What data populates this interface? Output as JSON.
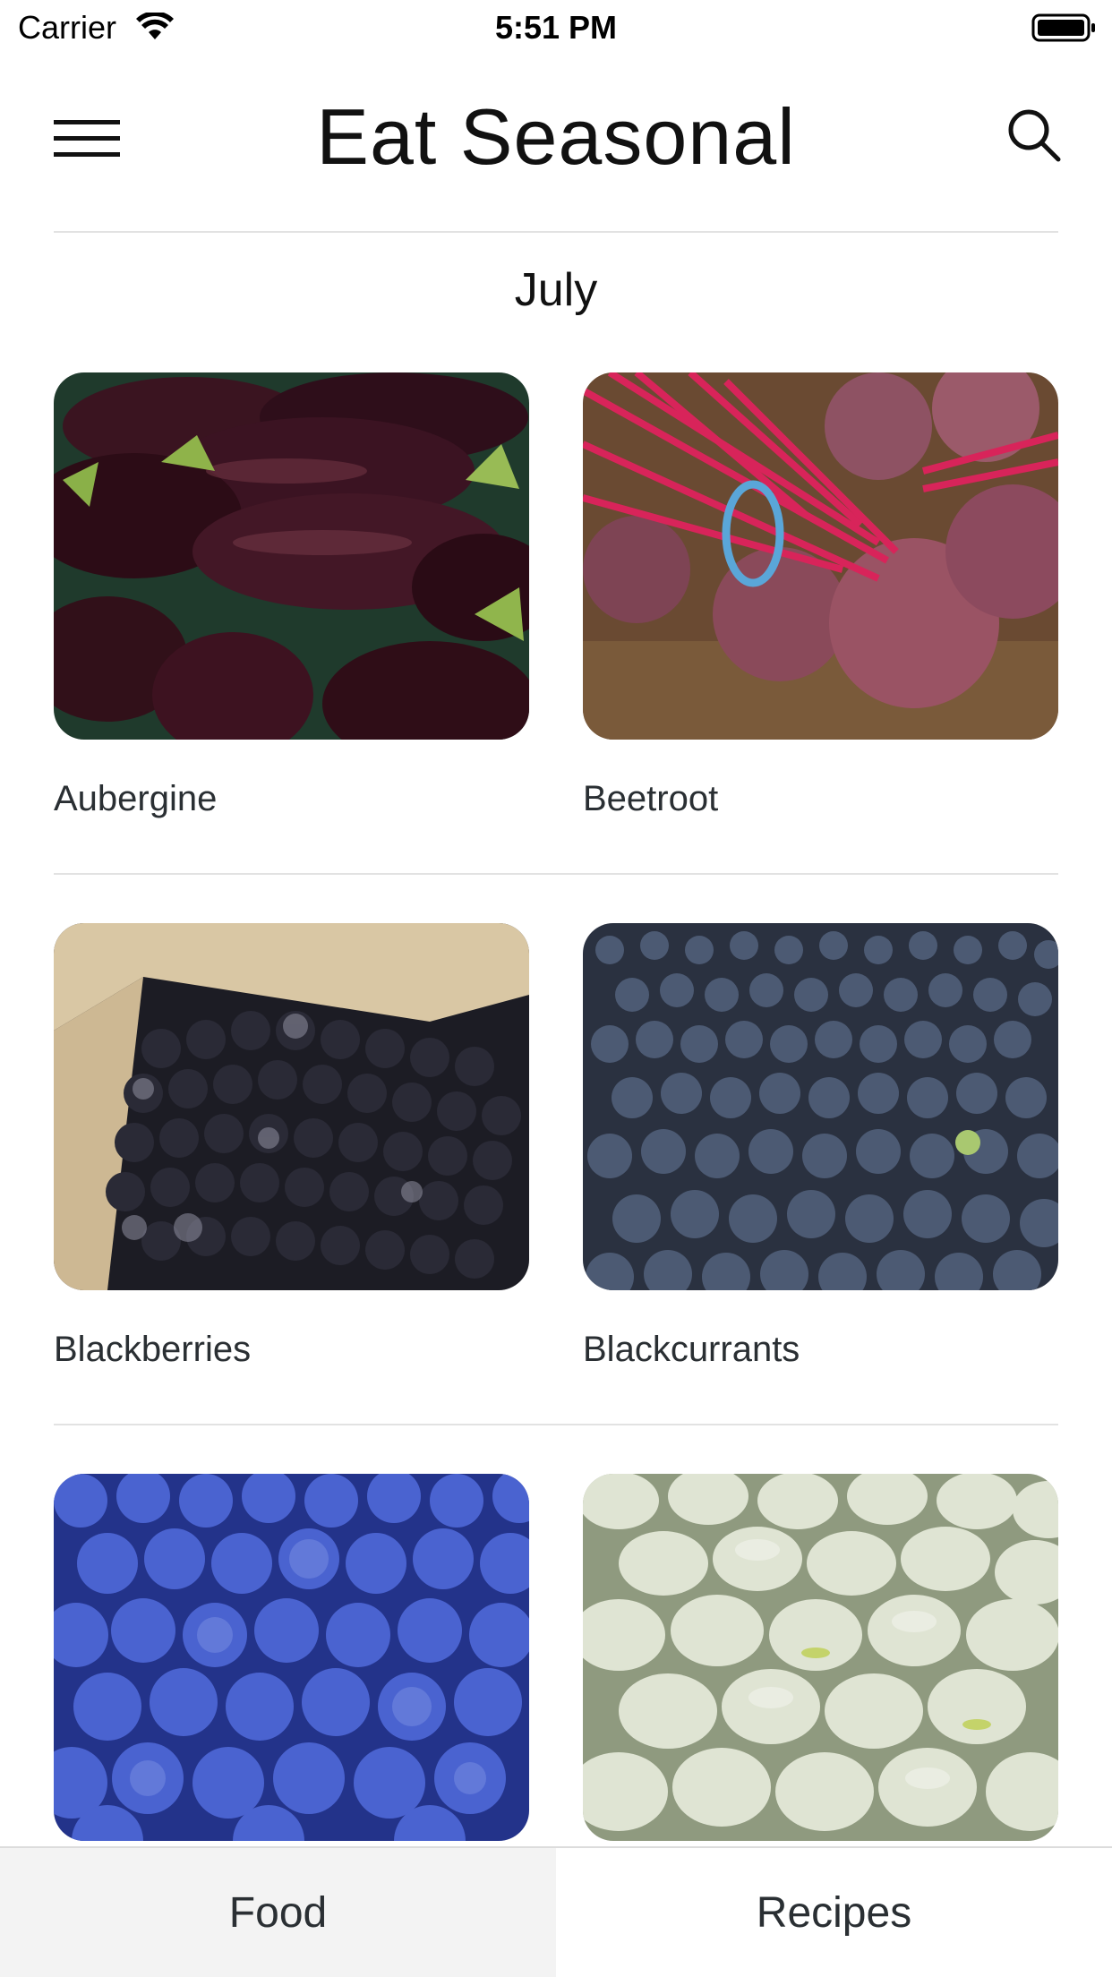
{
  "status_bar": {
    "carrier": "Carrier",
    "time": "5:51 PM",
    "icons": [
      "wifi-icon",
      "battery-icon"
    ]
  },
  "header": {
    "title": "Eat Seasonal",
    "menu_icon": "hamburger-menu-icon",
    "search_icon": "search-icon"
  },
  "month": "July",
  "items": [
    {
      "name": "Aubergine",
      "image": "aubergine-photo"
    },
    {
      "name": "Beetroot",
      "image": "beetroot-photo"
    },
    {
      "name": "Blackberries",
      "image": "blackberries-photo"
    },
    {
      "name": "Blackcurrants",
      "image": "blackcurrants-photo"
    },
    {
      "name": "",
      "image": "blueberries-photo"
    },
    {
      "name": "",
      "image": "broad-beans-photo"
    }
  ],
  "tabs": [
    {
      "label": "Food",
      "selected": true
    },
    {
      "label": "Recipes",
      "selected": false
    }
  ],
  "colors": {
    "selected_tab_bg": "#f3f3f3",
    "divider": "#e2e2e2"
  }
}
